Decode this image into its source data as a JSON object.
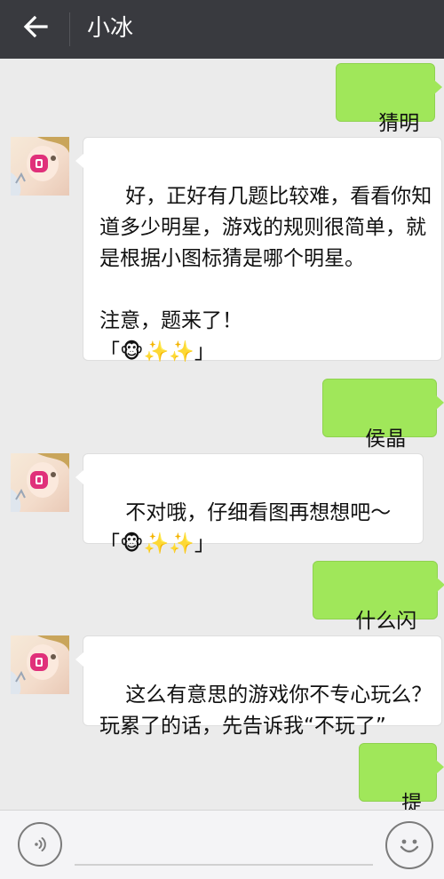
{
  "header": {
    "title": "小冰",
    "back_icon": "arrow-left-icon"
  },
  "messages": [
    {
      "side": "out",
      "text": "猜明星"
    },
    {
      "side": "in",
      "text": "好，正好有几题比较难，看看你知道多少明星，游戏的规则很简单，就是根据小图标猜是哪个明星。\n\n注意，题来了！\n「🐵✨✨」"
    },
    {
      "side": "out",
      "text": "侯晶晶？"
    },
    {
      "side": "in",
      "text": "不对哦，仔细看图再想想吧～\n「🐵✨✨」"
    },
    {
      "side": "out",
      "text": "什么闪闪"
    },
    {
      "side": "in",
      "text": "这么有意思的游戏你不专心玩么？玩累了的话，先告诉我“不玩了”"
    },
    {
      "side": "out",
      "text": "提示"
    }
  ],
  "input_bar": {
    "voice_icon": "voice-icon",
    "emoji_icon": "emoji-smile-icon",
    "input_value": ""
  },
  "colors": {
    "header_bg": "#393a3f",
    "chat_bg": "#ebebeb",
    "outgoing_bubble": "#a0e75a",
    "incoming_bubble": "#ffffff"
  }
}
